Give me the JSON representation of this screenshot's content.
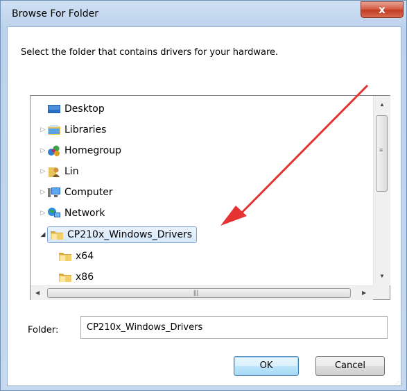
{
  "window": {
    "title": "Browse For Folder",
    "close_label": "x"
  },
  "prompt": "Select the folder that contains drivers for your hardware.",
  "tree": {
    "items": [
      {
        "label": "Desktop",
        "icon": "desktop-icon",
        "expander": ""
      },
      {
        "label": "Libraries",
        "icon": "libraries-icon",
        "expander": "▷"
      },
      {
        "label": "Homegroup",
        "icon": "homegroup-icon",
        "expander": "▷"
      },
      {
        "label": "Lin",
        "icon": "user-icon",
        "expander": "▷"
      },
      {
        "label": "Computer",
        "icon": "computer-icon",
        "expander": "▷"
      },
      {
        "label": "Network",
        "icon": "network-icon",
        "expander": "▷"
      },
      {
        "label": "CP210x_Windows_Drivers",
        "icon": "folder-icon",
        "expander": "◢",
        "selected": true
      },
      {
        "label": "x64",
        "icon": "folder-icon",
        "expander": ""
      },
      {
        "label": "x86",
        "icon": "folder-icon",
        "expander": ""
      }
    ]
  },
  "folder": {
    "label": "Folder:",
    "value": "CP210x_Windows_Drivers"
  },
  "buttons": {
    "ok": "OK",
    "cancel": "Cancel"
  },
  "colors": {
    "selection_bg": "#d6e8fb",
    "selection_border": "#7da2ce",
    "annotation_arrow": "#e53333"
  }
}
